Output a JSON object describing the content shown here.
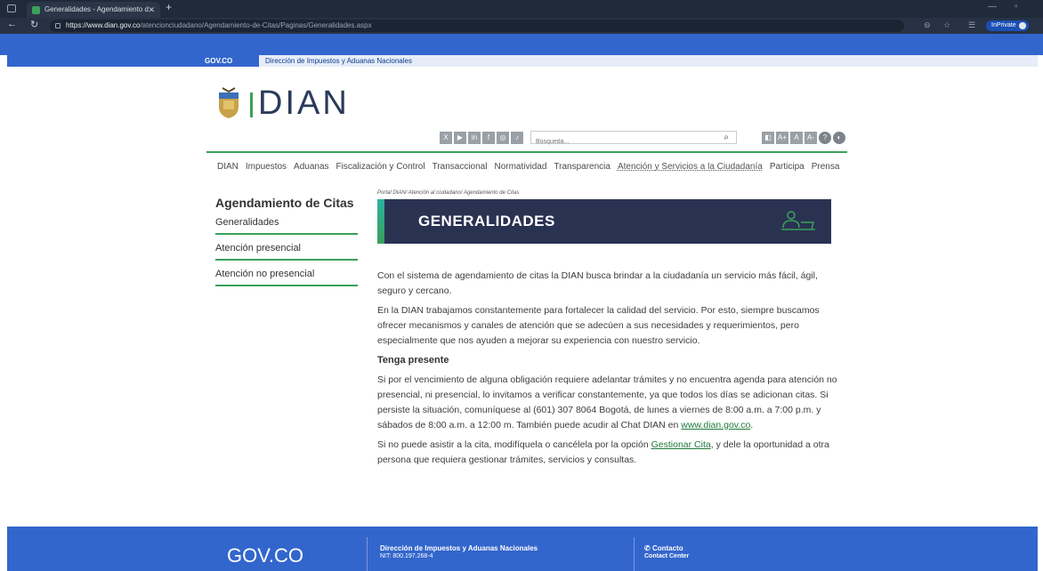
{
  "browser": {
    "tab_title": "Generalidades - Agendamiento d",
    "url_host": "https://www.dian.gov.co",
    "url_path": "/atencionciudadano/Agendamiento-de-Citas/Paginas/Generalidades.aspx",
    "inprivate_label": "InPrivate"
  },
  "gov_bar": {
    "logo": "GOV.CO",
    "entity": "Dirección de Impuestos y Aduanas Nacionales"
  },
  "header": {
    "brand": "DIAN",
    "search_placeholder": "Búsqueda...",
    "accessibility": [
      "A+",
      "A",
      "A-"
    ]
  },
  "main_menu": [
    "DIAN",
    "Impuestos",
    "Aduanas",
    "Fiscalización y Control",
    "Transaccional",
    "Normatividad",
    "Transparencia",
    "Atención y Servicios a la Ciudadanía",
    "Participa",
    "Prensa"
  ],
  "sidebar": {
    "title": "Agendamiento de Citas",
    "items": [
      "Generalidades",
      "Atención presencial",
      "Atención no presencial"
    ]
  },
  "breadcrumb": "Portal DIAN/  Atención al ciudadano/  Agendamiento de Citas",
  "banner_title": "GENERALIDADES",
  "content": {
    "p1": "Con el sistema de agendamiento de citas la DIAN busca brindar a la ciudadanía un servicio más fácil, ágil, seguro y cercano.",
    "p2": "En la DIAN trabajamos constantemente para fortalecer la calidad del servicio. Por esto, siempre buscamos ofrecer mecanismos y canales de atención que se adecúen a sus necesidades y requerimientos, pero especialmente que nos ayuden a mejorar su experiencia con nuestro servicio.",
    "heading": "Tenga presente",
    "p3": "Si por el vencimiento de alguna obligación requiere adelantar trámites y no encuentra agenda para atención no presencial, ni presencial, lo invitamos a verificar constantemente, ya que todos los días se adicionan citas. Si persiste la situación, comuníquese al (601) 307 8064 Bogotá, de lunes a viernes de 8:00 a.m. a 7:00 p.m. y sábados de 8:00 a.m. a 12:00 m. También puede acudir al Chat DIAN en ",
    "p3_link": "www.dian.gov.co",
    "p3_end": ".",
    "p4_start": "Si no puede asistir a la cita, modifíquela o cancélela por la opción ",
    "p4_link": "Gestionar Cita",
    "p4_end": ", y dele la oportunidad a otra persona que requiera gestionar trámites, servicios y consultas."
  },
  "footer": {
    "logo": "GOV.CO",
    "entity": "Dirección de Impuestos y Aduanas Nacionales",
    "nit": "NIT: 800.197.268-4",
    "contact_label": "Contacto",
    "contact_center": "Contact Center"
  }
}
